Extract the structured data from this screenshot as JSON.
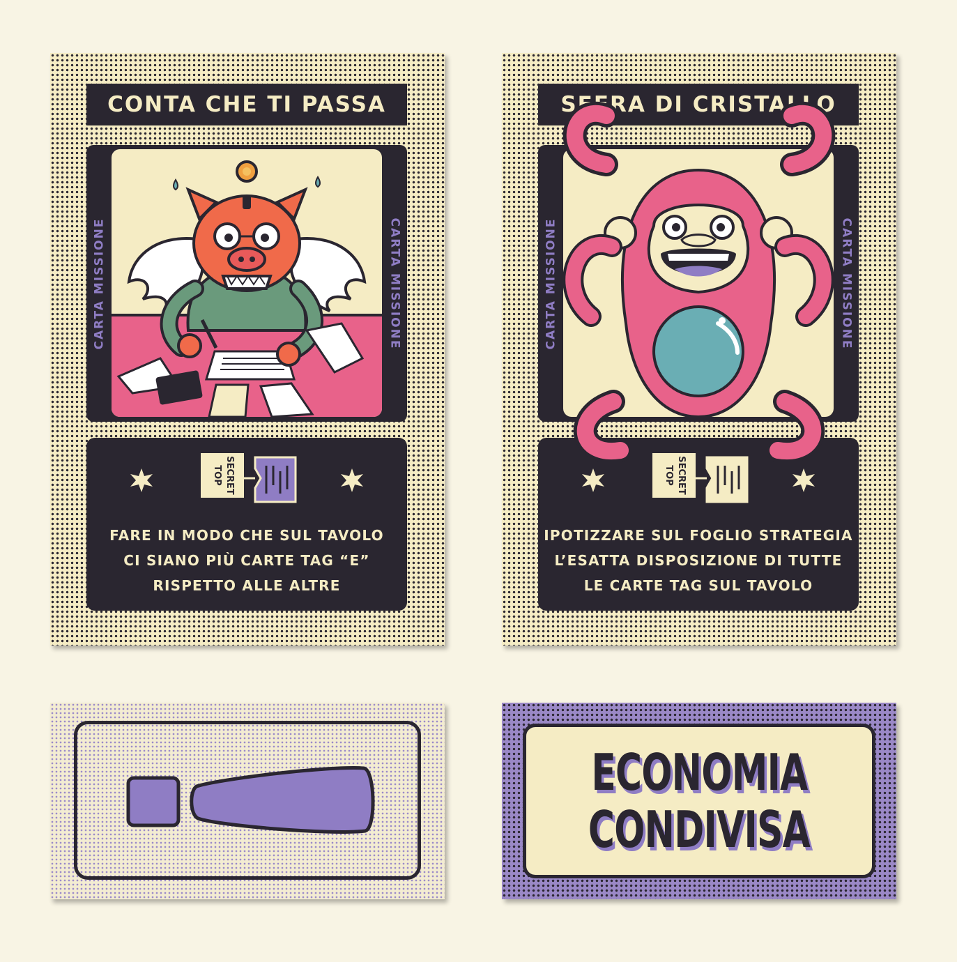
{
  "cards": [
    {
      "title": "CONTA CHE TI PASSA",
      "side_label": "CARTA MISSIONE",
      "tag_text": "TOP SECRET",
      "mission_lines": [
        "FARE IN MODO CHE SUL TAVOLO",
        "CI SIANO PIÙ CARTE TAG “E”",
        "RISPETTO ALLE ALTRE"
      ],
      "illustration": "winged-pig-accountant"
    },
    {
      "title": "SFERA DI CRISTALLO",
      "side_label": "CARTA MISSIONE",
      "tag_text": "TOP SECRET",
      "mission_lines": [
        "IPOTIZZARE SUL FOGLIO STRATEGIA",
        "L’ESATTA DISPOSIZIONE DI TUTTE",
        "LE CARTE TAG SUL TAVOLO"
      ],
      "illustration": "octopus-monkey-crystal-ball"
    }
  ],
  "card_back": {
    "icon": "exclamation-icon"
  },
  "tag_card": {
    "lines": [
      "ECONOMIA",
      "CONDIVISA"
    ]
  },
  "colors": {
    "ink": "#2a2630",
    "cream": "#f5ecc4",
    "purple": "#8f7dc4",
    "pink": "#e8628a",
    "orange": "#f06a4a",
    "green": "#6a9a7c",
    "teal": "#6aaeb4",
    "background": "#f8f4e4"
  }
}
